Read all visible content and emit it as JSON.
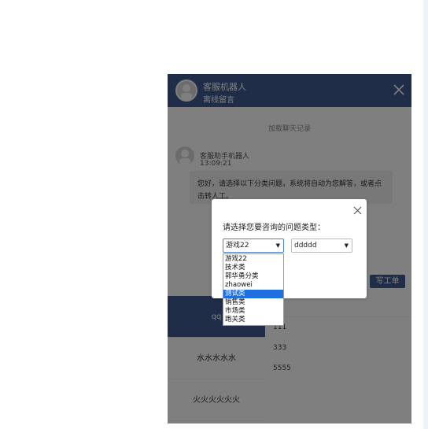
{
  "chat": {
    "title": "客服机器人",
    "status": "离线留言",
    "load_history": "加载聊天记录",
    "message": {
      "sender": "客服助手机器人",
      "time": "13:09:21",
      "text": "您好，请选择以下分类问题，系统将自动为您解答，或者点击转人工。"
    },
    "stub_input_value": "0",
    "ticket_button": "写工单",
    "left_items": [
      "qq",
      "水水水水水",
      "火火火火火火"
    ],
    "right_lines": [
      "111",
      "333",
      "5555"
    ]
  },
  "modal": {
    "question": "请选择您要咨询的问题类型：",
    "select_one_value": "游戏22",
    "select_two_value": "ddddd",
    "options": [
      "游戏22",
      "技术类",
      "郭华勇分类",
      "zhaowei",
      "测试类",
      "销售类",
      "市场类",
      "跑关类"
    ],
    "highlighted_option": "测试类"
  },
  "icons": {
    "chat_close": "close-icon",
    "modal_close": "close-icon",
    "dropdown_arrow": "caret-down-icon"
  },
  "colors": {
    "header": "#3e5b93",
    "highlight": "#1e6fdf"
  }
}
